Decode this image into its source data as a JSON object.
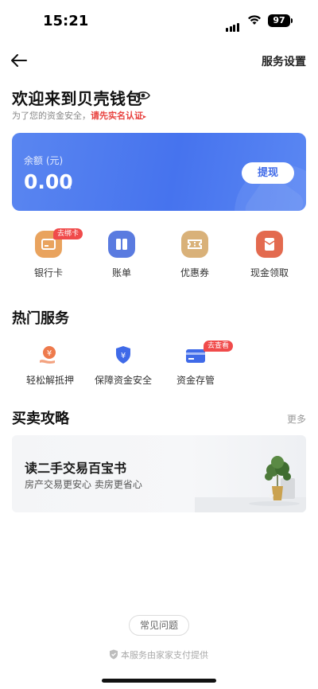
{
  "status": {
    "time": "15:21",
    "battery": "97"
  },
  "nav": {
    "right_label": "服务设置"
  },
  "header": {
    "welcome": "欢迎来到贝壳钱包",
    "sub_prefix": "为了您的资金安全，",
    "sub_link": "请先实名认证",
    "sub_link_arrow": "▸"
  },
  "balance": {
    "label": "余额 (元)",
    "value": "0.00",
    "arrow": "›",
    "withdraw": "提现"
  },
  "quick": [
    {
      "label": "银行卡",
      "tag": "去绑卡",
      "icon": "bank-card-icon",
      "color": "#e9a35e"
    },
    {
      "label": "账单",
      "icon": "bill-icon",
      "color": "#5a7be0"
    },
    {
      "label": "优惠券",
      "icon": "coupon-icon",
      "color": "#d9b179"
    },
    {
      "label": "现金领取",
      "icon": "red-envelope-icon",
      "color": "#e36a4f"
    }
  ],
  "hot": {
    "title": "热门服务",
    "items": [
      {
        "label": "轻松解抵押",
        "icon": "yuan-hand-icon",
        "color": "#ee7a4c"
      },
      {
        "label": "保障资金安全",
        "icon": "yuan-shield-icon",
        "color": "#3f6ae8"
      },
      {
        "label": "资金存管",
        "tag": "去查看",
        "icon": "card-icon",
        "color": "#3f6ae8"
      }
    ]
  },
  "guide": {
    "title": "买卖攻略",
    "more": "更多",
    "banner_title": "读二手交易百宝书",
    "banner_sub": "房产交易更安心  卖房更省心"
  },
  "footer": {
    "faq": "常见问题",
    "provider": "本服务由家家支付提供"
  }
}
